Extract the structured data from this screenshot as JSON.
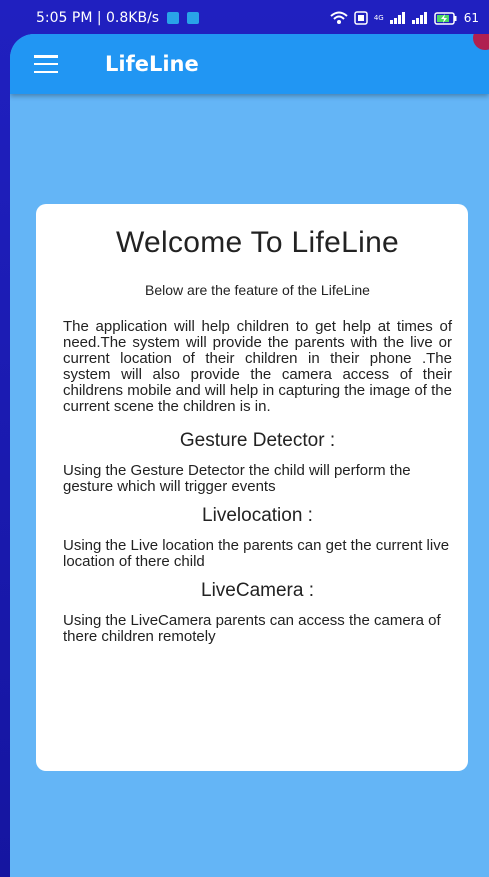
{
  "status_bar": {
    "time_speed": "5:05 PM | 0.8KB/s",
    "net_label": "4G",
    "battery": "61"
  },
  "app_bar": {
    "title": "LifeLine"
  },
  "card": {
    "heading": "Welcome To LifeLine",
    "subtitle": "Below are the feature of the LifeLine",
    "description": "The application will help children to get help at times of need.The system will provide the parents with the live or current location of their children in their phone .The system will also provide the camera access of their childrens mobile and will help in capturing the image of the current scene the children is in.",
    "sections": [
      {
        "title": "Gesture Detector :",
        "body": "Using the Gesture Detector the child will perform the gesture which will trigger events"
      },
      {
        "title": "Livelocation :",
        "body": "Using the Live location the parents can get the current live location of there child"
      },
      {
        "title": "LiveCamera :",
        "body": "Using the LiveCamera parents can access the camera of there children remotely"
      }
    ]
  },
  "colors": {
    "app_bar": "#2196f3",
    "background": "#64b5f6",
    "outer_frame": "#1a1aa8"
  }
}
